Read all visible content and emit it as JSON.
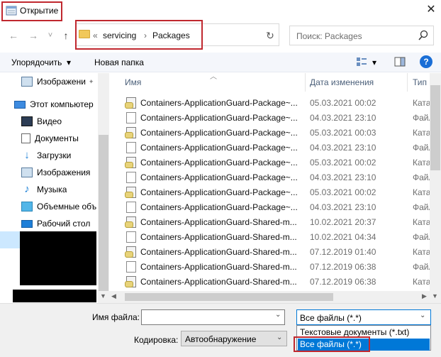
{
  "window": {
    "title": "Открытие",
    "close_glyph": "✕"
  },
  "nav": {
    "back_glyph": "←",
    "forward_glyph": "→",
    "recent_glyph": "˅",
    "up_glyph": "↑",
    "address": {
      "overflow": "«",
      "crumbs": [
        "servicing",
        "Packages"
      ],
      "separator": "›"
    },
    "refresh_glyph": "↻",
    "search_placeholder": "Поиск: Packages"
  },
  "toolbar": {
    "organize_label": "Упорядочить",
    "organize_caret": "▾",
    "new_folder_label": "Новая папка",
    "view_caret": "▾",
    "help_glyph": "?"
  },
  "sidebar": {
    "items": [
      {
        "label": "Изображени",
        "icon": "pictures-icon",
        "pinned": true
      },
      {
        "label": "Этот компьютер",
        "icon": "computer-icon"
      },
      {
        "label": "Видео",
        "icon": "video-icon"
      },
      {
        "label": "Документы",
        "icon": "documents-icon"
      },
      {
        "label": "Загрузки",
        "icon": "downloads-icon"
      },
      {
        "label": "Изображения",
        "icon": "pictures-icon"
      },
      {
        "label": "Музыка",
        "icon": "music-icon"
      },
      {
        "label": "Объемные объ",
        "icon": "3d-objects-icon"
      },
      {
        "label": "Рабочий стол",
        "icon": "desktop-icon"
      }
    ],
    "pin_glyph": "📌"
  },
  "list": {
    "columns": {
      "name": "Имя",
      "date": "Дата изменения",
      "type": "Тип"
    },
    "rows": [
      {
        "name": "Containers-ApplicationGuard-Package~...",
        "date": "05.03.2021 00:02",
        "type": "Ката",
        "kind": "cab"
      },
      {
        "name": "Containers-ApplicationGuard-Package~...",
        "date": "04.03.2021 23:10",
        "type": "Файл",
        "kind": "file"
      },
      {
        "name": "Containers-ApplicationGuard-Package~...",
        "date": "05.03.2021 00:03",
        "type": "Ката",
        "kind": "cab"
      },
      {
        "name": "Containers-ApplicationGuard-Package~...",
        "date": "04.03.2021 23:10",
        "type": "Файл",
        "kind": "file"
      },
      {
        "name": "Containers-ApplicationGuard-Package~...",
        "date": "05.03.2021 00:02",
        "type": "Ката",
        "kind": "cab"
      },
      {
        "name": "Containers-ApplicationGuard-Package~...",
        "date": "04.03.2021 23:10",
        "type": "Файл",
        "kind": "file"
      },
      {
        "name": "Containers-ApplicationGuard-Package~...",
        "date": "05.03.2021 00:02",
        "type": "Ката",
        "kind": "cab"
      },
      {
        "name": "Containers-ApplicationGuard-Package~...",
        "date": "04.03.2021 23:10",
        "type": "Файл",
        "kind": "file"
      },
      {
        "name": "Containers-ApplicationGuard-Shared-m...",
        "date": "10.02.2021 20:37",
        "type": "Ката",
        "kind": "cab"
      },
      {
        "name": "Containers-ApplicationGuard-Shared-m...",
        "date": "10.02.2021 04:34",
        "type": "Файл",
        "kind": "file"
      },
      {
        "name": "Containers-ApplicationGuard-Shared-m...",
        "date": "07.12.2019 01:40",
        "type": "Ката",
        "kind": "cab"
      },
      {
        "name": "Containers-ApplicationGuard-Shared-m...",
        "date": "07.12.2019 06:38",
        "type": "Файл",
        "kind": "file"
      },
      {
        "name": "Containers-ApplicationGuard-Shared-m...",
        "date": "07.12.2019 06:38",
        "type": "Ката",
        "kind": "cab"
      }
    ]
  },
  "bottom": {
    "filename_label": "Имя файла:",
    "filename_value": "",
    "encoding_label": "Кодировка:",
    "encoding_value": "Автообнаружение",
    "filter_value": "Все файлы  (*.*)",
    "filter_options": [
      "Текстовые документы (*.txt)",
      "Все файлы  (*.*)"
    ],
    "caret_glyph": "⌄"
  }
}
